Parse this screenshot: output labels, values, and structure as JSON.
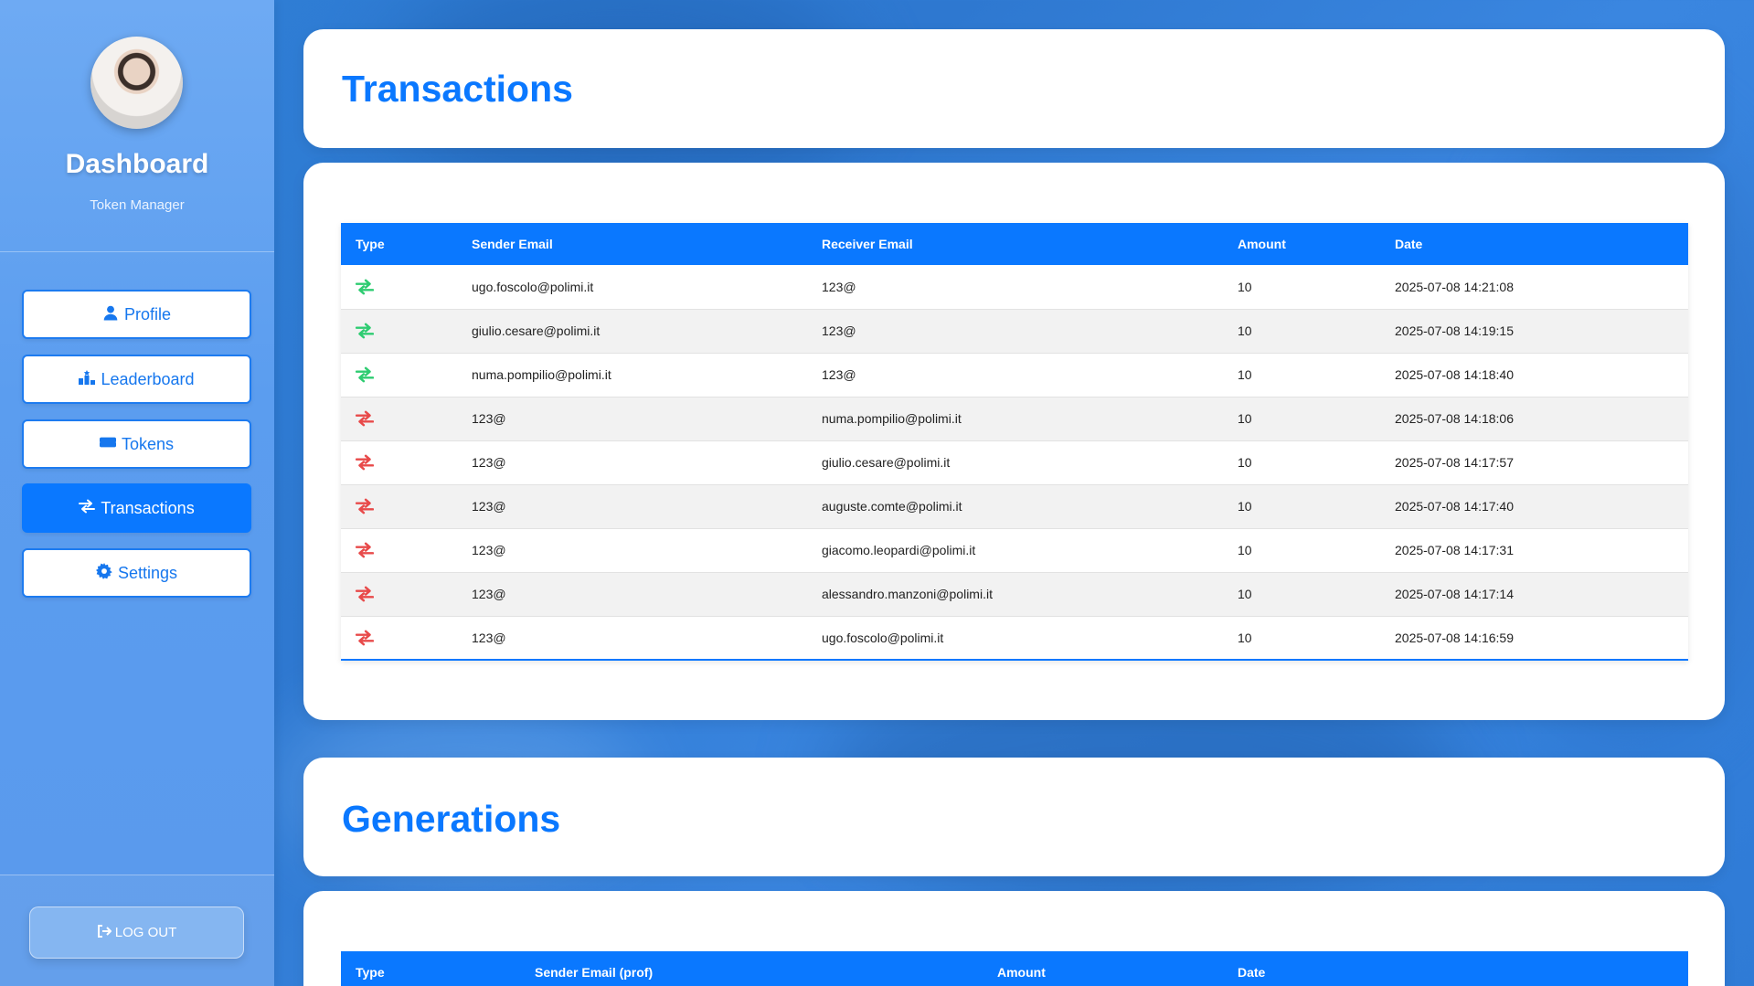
{
  "sidebar": {
    "title": "Dashboard",
    "subtitle": "Token Manager",
    "nav": [
      {
        "label": "Profile",
        "icon": "user-icon"
      },
      {
        "label": "Leaderboard",
        "icon": "podium-icon"
      },
      {
        "label": "Tokens",
        "icon": "ticket-icon"
      },
      {
        "label": "Transactions",
        "icon": "exchange-icon",
        "active": true
      },
      {
        "label": "Settings",
        "icon": "gear-icon"
      }
    ],
    "logout_label": "LOG OUT"
  },
  "colors": {
    "accent": "#0a78ff",
    "incoming": "#2ecc71",
    "outgoing": "#e84a4a"
  },
  "transactions": {
    "title": "Transactions",
    "headers": [
      "Type",
      "Sender Email",
      "Receiver Email",
      "Amount",
      "Date"
    ],
    "rows": [
      {
        "direction": "incoming",
        "sender": "ugo.foscolo@polimi.it",
        "receiver": "123@",
        "amount": "10",
        "date": "2025-07-08 14:21:08"
      },
      {
        "direction": "incoming",
        "sender": "giulio.cesare@polimi.it",
        "receiver": "123@",
        "amount": "10",
        "date": "2025-07-08 14:19:15"
      },
      {
        "direction": "incoming",
        "sender": "numa.pompilio@polimi.it",
        "receiver": "123@",
        "amount": "10",
        "date": "2025-07-08 14:18:40"
      },
      {
        "direction": "outgoing",
        "sender": "123@",
        "receiver": "numa.pompilio@polimi.it",
        "amount": "10",
        "date": "2025-07-08 14:18:06"
      },
      {
        "direction": "outgoing",
        "sender": "123@",
        "receiver": "giulio.cesare@polimi.it",
        "amount": "10",
        "date": "2025-07-08 14:17:57"
      },
      {
        "direction": "outgoing",
        "sender": "123@",
        "receiver": "auguste.comte@polimi.it",
        "amount": "10",
        "date": "2025-07-08 14:17:40"
      },
      {
        "direction": "outgoing",
        "sender": "123@",
        "receiver": "giacomo.leopardi@polimi.it",
        "amount": "10",
        "date": "2025-07-08 14:17:31"
      },
      {
        "direction": "outgoing",
        "sender": "123@",
        "receiver": "alessandro.manzoni@polimi.it",
        "amount": "10",
        "date": "2025-07-08 14:17:14"
      },
      {
        "direction": "outgoing",
        "sender": "123@",
        "receiver": "ugo.foscolo@polimi.it",
        "amount": "10",
        "date": "2025-07-08 14:16:59"
      }
    ]
  },
  "generations": {
    "title": "Generations",
    "headers": [
      "Type",
      "Sender Email (prof)",
      "Amount",
      "Date"
    ]
  }
}
